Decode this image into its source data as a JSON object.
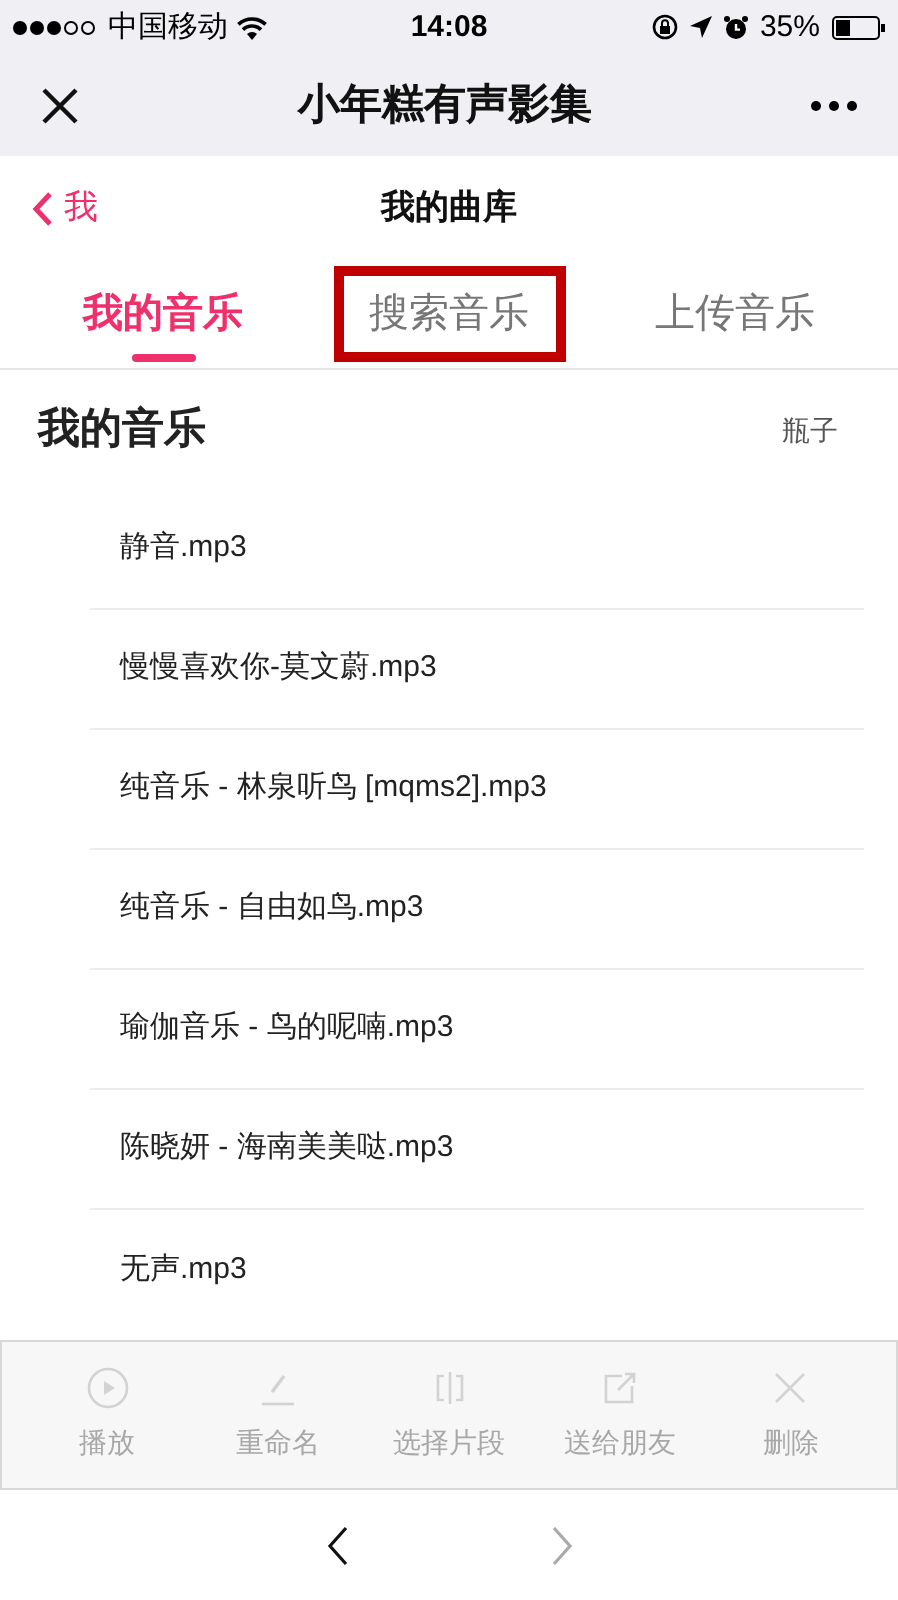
{
  "status_bar": {
    "carrier": "中国移动",
    "time": "14:08",
    "battery": "35%"
  },
  "nav_bar": {
    "title": "小年糕有声影集"
  },
  "header": {
    "back_label": "我",
    "title": "我的曲库"
  },
  "tabs": [
    {
      "label": "我的音乐",
      "selected": true,
      "highlighted": false
    },
    {
      "label": "搜索音乐",
      "selected": false,
      "highlighted": true
    },
    {
      "label": "上传音乐",
      "selected": false,
      "highlighted": false
    }
  ],
  "section": {
    "title": "我的音乐",
    "owner": "瓶子"
  },
  "songs": [
    {
      "name": "静音.mp3"
    },
    {
      "name": "慢慢喜欢你-莫文蔚.mp3"
    },
    {
      "name": "纯音乐 - 林泉听鸟 [mqms2].mp3"
    },
    {
      "name": "纯音乐 - 自由如鸟.mp3"
    },
    {
      "name": "瑜伽音乐 - 鸟的呢喃.mp3"
    },
    {
      "name": "陈晓妍 - 海南美美哒.mp3"
    },
    {
      "name": "无声.mp3"
    }
  ],
  "toolbar": [
    {
      "kind": "play",
      "label": "播放",
      "disabled": true
    },
    {
      "kind": "rename",
      "label": "重命名",
      "disabled": true
    },
    {
      "kind": "clip",
      "label": "选择片段",
      "disabled": true
    },
    {
      "kind": "share",
      "label": "送给朋友",
      "disabled": true
    },
    {
      "kind": "delete",
      "label": "删除",
      "disabled": true
    }
  ],
  "browser_nav": {
    "back": {
      "disabled": false
    },
    "forward": {
      "disabled": true
    }
  }
}
